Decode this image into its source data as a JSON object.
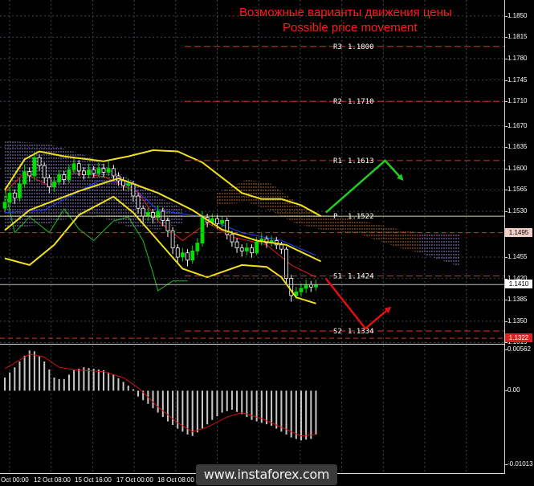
{
  "title": {
    "line1": "Возможные варианты движения цены",
    "line2": "Possible price movement"
  },
  "watermark": "www.instaforex.com",
  "colors": {
    "background": "#000000",
    "bull": "#00e000",
    "bear": "#000000",
    "wick": "#ffffff",
    "title": "#ff1a1a",
    "level": "#d83030",
    "pivot": "#d8d8a0",
    "macd_bar": "#c8c8c8",
    "macd_signal": "#d01010"
  },
  "chart_data": [
    {
      "type": "bar",
      "ylim": [
        1.1313,
        1.1876
      ],
      "y_ticks": [
        "1.1850",
        "1.1815",
        "1.1780",
        "1.1745",
        "1.1710",
        "1.1670",
        "1.1635",
        "1.1600",
        "1.1565",
        "1.1530",
        "1.1455",
        "1.1420",
        "1.1385",
        "1.1350",
        "1.1315"
      ],
      "x_ticks": [
        "Oct 00:00",
        "12 Oct 08:00",
        "15 Oct 16:00",
        "17 Oct 00:00",
        "18 Oct 08:00"
      ],
      "candles": [
        [
          1.1535,
          1.1556,
          1.1528,
          1.1545
        ],
        [
          1.1545,
          1.157,
          1.1538,
          1.156
        ],
        [
          1.156,
          1.1566,
          1.1542,
          1.1552
        ],
        [
          1.1552,
          1.1584,
          1.1546,
          1.1575
        ],
        [
          1.1575,
          1.1606,
          1.1568,
          1.1595
        ],
        [
          1.1595,
          1.1602,
          1.1578,
          1.1588
        ],
        [
          1.1588,
          1.1628,
          1.158,
          1.1618
        ],
        [
          1.1618,
          1.1624,
          1.1596,
          1.1605
        ],
        [
          1.1605,
          1.161,
          1.1576,
          1.1585
        ],
        [
          1.1585,
          1.159,
          1.156,
          1.157
        ],
        [
          1.157,
          1.1586,
          1.1562,
          1.1578
        ],
        [
          1.1578,
          1.1598,
          1.1572,
          1.159
        ],
        [
          1.159,
          1.1596,
          1.1574,
          1.1582
        ],
        [
          1.1582,
          1.1606,
          1.1576,
          1.1598
        ],
        [
          1.1598,
          1.1618,
          1.1592,
          1.1608
        ],
        [
          1.1608,
          1.1614,
          1.1588,
          1.1596
        ],
        [
          1.1596,
          1.1602,
          1.1582,
          1.159
        ],
        [
          1.159,
          1.1608,
          1.1584,
          1.1598
        ],
        [
          1.1598,
          1.1604,
          1.1585,
          1.1592
        ],
        [
          1.1592,
          1.161,
          1.1586,
          1.16
        ],
        [
          1.16,
          1.1608,
          1.1586,
          1.1594
        ],
        [
          1.1594,
          1.1612,
          1.1588,
          1.16
        ],
        [
          1.16,
          1.1606,
          1.158,
          1.1588
        ],
        [
          1.1588,
          1.1594,
          1.1572,
          1.158
        ],
        [
          1.158,
          1.1586,
          1.1564,
          1.1572
        ],
        [
          1.1572,
          1.1584,
          1.1562,
          1.1575
        ],
        [
          1.1575,
          1.158,
          1.1546,
          1.1555
        ],
        [
          1.1555,
          1.156,
          1.1526,
          1.1535
        ],
        [
          1.1535,
          1.154,
          1.1512,
          1.1522
        ],
        [
          1.1522,
          1.1536,
          1.1514,
          1.1528
        ],
        [
          1.1528,
          1.1534,
          1.151,
          1.152
        ],
        [
          1.152,
          1.154,
          1.1514,
          1.153
        ],
        [
          1.153,
          1.1536,
          1.1506,
          1.1515
        ],
        [
          1.1515,
          1.152,
          1.1488,
          1.1498
        ],
        [
          1.1498,
          1.1504,
          1.146,
          1.147
        ],
        [
          1.147,
          1.1476,
          1.1444,
          1.1455
        ],
        [
          1.1455,
          1.147,
          1.1448,
          1.1462
        ],
        [
          1.1462,
          1.1468,
          1.144,
          1.145
        ],
        [
          1.145,
          1.1474,
          1.1444,
          1.1465
        ],
        [
          1.1465,
          1.1486,
          1.1458,
          1.1478
        ],
        [
          1.1478,
          1.153,
          1.1472,
          1.152
        ],
        [
          1.152,
          1.1526,
          1.1504,
          1.1512
        ],
        [
          1.1512,
          1.1526,
          1.1506,
          1.1518
        ],
        [
          1.1518,
          1.1524,
          1.1502,
          1.151
        ],
        [
          1.151,
          1.1522,
          1.1504,
          1.1515
        ],
        [
          1.1515,
          1.152,
          1.1484,
          1.1492
        ],
        [
          1.1492,
          1.1498,
          1.1472,
          1.148
        ],
        [
          1.148,
          1.1486,
          1.1462,
          1.147
        ],
        [
          1.147,
          1.1476,
          1.1456,
          1.1465
        ],
        [
          1.1465,
          1.1478,
          1.1458,
          1.147
        ],
        [
          1.147,
          1.1476,
          1.1454,
          1.1462
        ],
        [
          1.1462,
          1.1488,
          1.1458,
          1.148
        ],
        [
          1.148,
          1.1494,
          1.1474,
          1.1485
        ],
        [
          1.1485,
          1.149,
          1.147,
          1.1478
        ],
        [
          1.1478,
          1.149,
          1.1472,
          1.1482
        ],
        [
          1.1482,
          1.1488,
          1.1468,
          1.1475
        ],
        [
          1.1475,
          1.148,
          1.146,
          1.1468
        ],
        [
          1.1468,
          1.1472,
          1.1412,
          1.142
        ],
        [
          1.142,
          1.1426,
          1.1382,
          1.1392
        ],
        [
          1.1392,
          1.1406,
          1.1386,
          1.1398
        ],
        [
          1.1398,
          1.1412,
          1.139,
          1.1404
        ],
        [
          1.1404,
          1.1418,
          1.1396,
          1.141
        ],
        [
          1.141,
          1.1416,
          1.1398,
          1.1406
        ],
        [
          1.1406,
          1.1418,
          1.14,
          1.141
        ]
      ],
      "clouds": [
        {
          "color": "#a898d8",
          "top": [
            [
              0,
              1.1646
            ],
            [
              9,
              1.164
            ],
            [
              17,
              1.162
            ],
            [
              25,
              1.1584
            ],
            [
              31,
              1.1554
            ],
            [
              36,
              1.1535
            ]
          ],
          "bottom": [
            [
              0,
              1.15
            ],
            [
              9,
              1.151
            ],
            [
              17,
              1.1527
            ],
            [
              25,
              1.1505
            ],
            [
              31,
              1.15
            ],
            [
              36,
              1.151
            ]
          ]
        },
        {
          "color": "#c87840",
          "top": [
            [
              43,
              1.156
            ],
            [
              49,
              1.1582
            ],
            [
              54,
              1.1575
            ],
            [
              59,
              1.1545
            ],
            [
              64,
              1.1525
            ],
            [
              72,
              1.1515
            ],
            [
              80,
              1.15
            ],
            [
              84,
              1.1495
            ]
          ],
          "bottom": [
            [
              43,
              1.154
            ],
            [
              49,
              1.1545
            ],
            [
              54,
              1.153
            ],
            [
              59,
              1.151
            ],
            [
              64,
              1.15
            ],
            [
              72,
              1.1492
            ],
            [
              80,
              1.147
            ],
            [
              84,
              1.1462
            ]
          ]
        },
        {
          "color": "#a898d8",
          "top": [
            [
              84,
              1.1495
            ],
            [
              92,
              1.1492
            ]
          ],
          "bottom": [
            [
              84,
              1.1462
            ],
            [
              92,
              1.144
            ]
          ]
        }
      ],
      "back_lines": [
        {
          "color": "#2040ff",
          "points": [
            [
              0,
              1.1528
            ],
            [
              8,
              1.1532
            ],
            [
              19,
              1.158
            ],
            [
              25,
              1.1576
            ],
            [
              31,
              1.1532
            ],
            [
              40,
              1.1521
            ],
            [
              48,
              1.1495
            ],
            [
              56,
              1.1482
            ],
            [
              63,
              1.1458
            ]
          ]
        },
        {
          "color": "#e02020",
          "points": [
            [
              0,
              1.1561
            ],
            [
              4,
              1.1593
            ],
            [
              9,
              1.1571
            ],
            [
              14,
              1.1593
            ],
            [
              20,
              1.1587
            ],
            [
              27,
              1.1561
            ],
            [
              31,
              1.1514
            ],
            [
              36,
              1.1482
            ],
            [
              41,
              1.1511
            ],
            [
              46,
              1.1488
            ],
            [
              53,
              1.1475
            ],
            [
              58,
              1.1442
            ],
            [
              63,
              1.1422
            ]
          ]
        },
        {
          "color": "#20c020",
          "points": [
            [
              0,
              1.1567
            ],
            [
              2,
              1.1495
            ],
            [
              5,
              1.1521
            ],
            [
              9,
              1.1495
            ],
            [
              12,
              1.1534
            ],
            [
              15,
              1.1501
            ],
            [
              18,
              1.1482
            ],
            [
              22,
              1.1514
            ],
            [
              25,
              1.1521
            ],
            [
              28,
              1.1482
            ],
            [
              30,
              1.1429
            ],
            [
              31,
              1.14
            ],
            [
              34,
              1.1416
            ],
            [
              37,
              1.1416
            ]
          ]
        }
      ],
      "bands": [
        {
          "color": "#f0e020",
          "points": [
            [
              0,
              1.1565
            ],
            [
              4,
              1.1615
            ],
            [
              7,
              1.1628
            ],
            [
              12,
              1.162
            ],
            [
              20,
              1.1612
            ],
            [
              25,
              1.162
            ],
            [
              30,
              1.163
            ],
            [
              35,
              1.1628
            ],
            [
              40,
              1.161
            ],
            [
              44,
              1.1585
            ],
            [
              48,
              1.156
            ],
            [
              52,
              1.155
            ],
            [
              56,
              1.155
            ],
            [
              60,
              1.154
            ],
            [
              64,
              1.1522
            ]
          ]
        },
        {
          "color": "#f0e020",
          "points": [
            [
              0,
              1.1499
            ],
            [
              5,
              1.1532
            ],
            [
              15,
              1.1563
            ],
            [
              23,
              1.1584
            ],
            [
              31,
              1.156
            ],
            [
              38,
              1.1532
            ],
            [
              44,
              1.15
            ],
            [
              51,
              1.1482
            ],
            [
              57,
              1.1475
            ],
            [
              64,
              1.1448
            ]
          ]
        },
        {
          "color": "#f0e020",
          "points": [
            [
              0,
              1.1453
            ],
            [
              5,
              1.1442
            ],
            [
              10,
              1.1475
            ],
            [
              15,
              1.1524
            ],
            [
              22,
              1.1554
            ],
            [
              26,
              1.1528
            ],
            [
              31,
              1.1482
            ],
            [
              36,
              1.1436
            ],
            [
              41,
              1.1422
            ],
            [
              48,
              1.1442
            ],
            [
              53,
              1.1439
            ],
            [
              56,
              1.1422
            ],
            [
              59,
              1.1389
            ],
            [
              63,
              1.1379
            ]
          ]
        }
      ],
      "levels": [
        {
          "label": "R3",
          "text": "1.1800",
          "value": 1.18
        },
        {
          "label": "R2",
          "text": "1.1710",
          "value": 1.171
        },
        {
          "label": "R1",
          "text": "1.1613",
          "value": 1.1613
        },
        {
          "label": "P",
          "text": "1.1522",
          "value": 1.1522
        },
        {
          "label": "S1",
          "text": "1.1424",
          "value": 1.1424
        },
        {
          "label": "S2",
          "text": "1.1334",
          "value": 1.1334
        }
      ],
      "price_markers": [
        {
          "text": "1.1495",
          "value": 1.1495,
          "bg": "#f2cfc6",
          "fg": "#000000",
          "line_color": "#d83030",
          "dashed": true
        },
        {
          "text": "1.1410",
          "value": 1.141,
          "bg": "#ffffff",
          "fg": "#000000",
          "line_color": "#c0c0c0",
          "dashed": false
        },
        {
          "text": "1.1322",
          "value": 1.1322,
          "bg": "#e02020",
          "fg": "#ffffff",
          "line_color": "#d83030",
          "dashed": true
        }
      ],
      "projections": [
        {
          "color": "#22cc22",
          "points": [
            [
              65,
              1.1528
            ],
            [
              77,
              1.1613
            ],
            [
              80.5,
              1.1582
            ]
          ]
        },
        {
          "color": "#e01010",
          "points": [
            [
              65,
              1.142
            ],
            [
              73,
              1.1338
            ],
            [
              78,
              1.1372
            ]
          ]
        }
      ]
    },
    {
      "type": "bar",
      "ylim": [
        -0.0114,
        0.0062
      ],
      "y_ticks": [
        "0.00562",
        "0.00",
        "-0.01013"
      ],
      "values": [
        0.0018,
        0.0025,
        0.0032,
        0.004,
        0.0048,
        0.0055,
        0.0054,
        0.0047,
        0.004,
        0.0029,
        0.0018,
        0.0016,
        0.0016,
        0.0022,
        0.0028,
        0.003,
        0.0032,
        0.0031,
        0.003,
        0.0029,
        0.0028,
        0.0025,
        0.0022,
        0.0017,
        0.0012,
        0.0007,
        0.0002,
        -0.0008,
        -0.0013,
        -0.0018,
        -0.0024,
        -0.003,
        -0.0036,
        -0.0042,
        -0.0047,
        -0.0052,
        -0.0056,
        -0.006,
        -0.0062,
        -0.0057,
        -0.0052,
        -0.0046,
        -0.004,
        -0.0035,
        -0.003,
        -0.0028,
        -0.0026,
        -0.0029,
        -0.0032,
        -0.0036,
        -0.004,
        -0.0042,
        -0.0044,
        -0.0046,
        -0.0048,
        -0.0052,
        -0.0056,
        -0.006,
        -0.0064,
        -0.0066,
        -0.0068,
        -0.0067,
        -0.0066,
        -0.006
      ],
      "signal": [
        [
          0,
          0.003
        ],
        [
          5,
          0.005
        ],
        [
          8,
          0.0046
        ],
        [
          11,
          0.0032
        ],
        [
          15,
          0.0028
        ],
        [
          20,
          0.0026
        ],
        [
          24,
          0.0018
        ],
        [
          27,
          0.0004
        ],
        [
          31,
          -0.0022
        ],
        [
          35,
          -0.0044
        ],
        [
          38,
          -0.0056
        ],
        [
          41,
          -0.005
        ],
        [
          45,
          -0.0036
        ],
        [
          48,
          -0.003
        ],
        [
          52,
          -0.0038
        ],
        [
          56,
          -0.005
        ],
        [
          60,
          -0.0062
        ],
        [
          63,
          -0.006
        ]
      ]
    }
  ]
}
